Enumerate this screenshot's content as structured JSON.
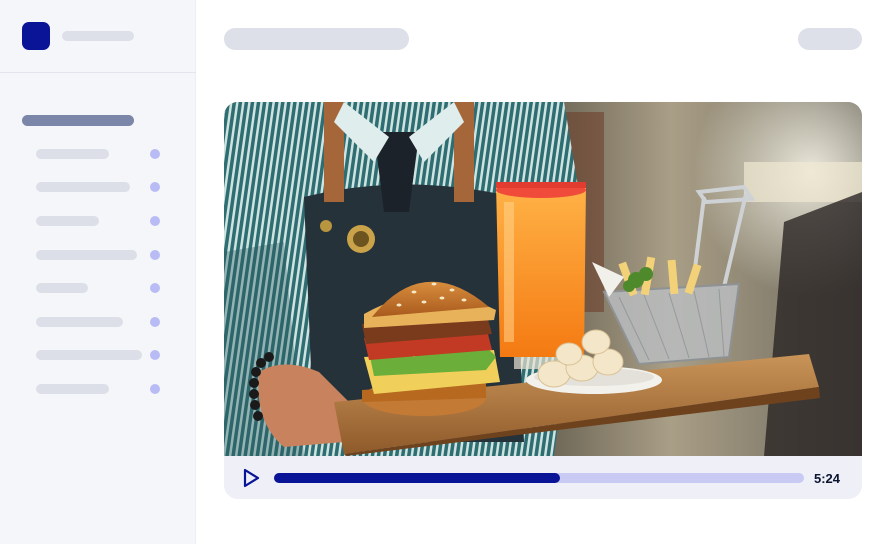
{
  "colors": {
    "brand": "#0a1496",
    "accent_dot": "#b9bcf4",
    "section_title": "#7b86a8",
    "progress_fill": "#0a1496",
    "progress_track": "#c9caf4",
    "play_icon": "#0a1496"
  },
  "sidebar": {
    "nav_count": 8
  },
  "video": {
    "scene": "waiter-holding-tray-with-burger-juice-and-fries",
    "progress_fraction": 0.54,
    "time_display": "5:24"
  },
  "icons": {
    "play": "play-icon"
  }
}
